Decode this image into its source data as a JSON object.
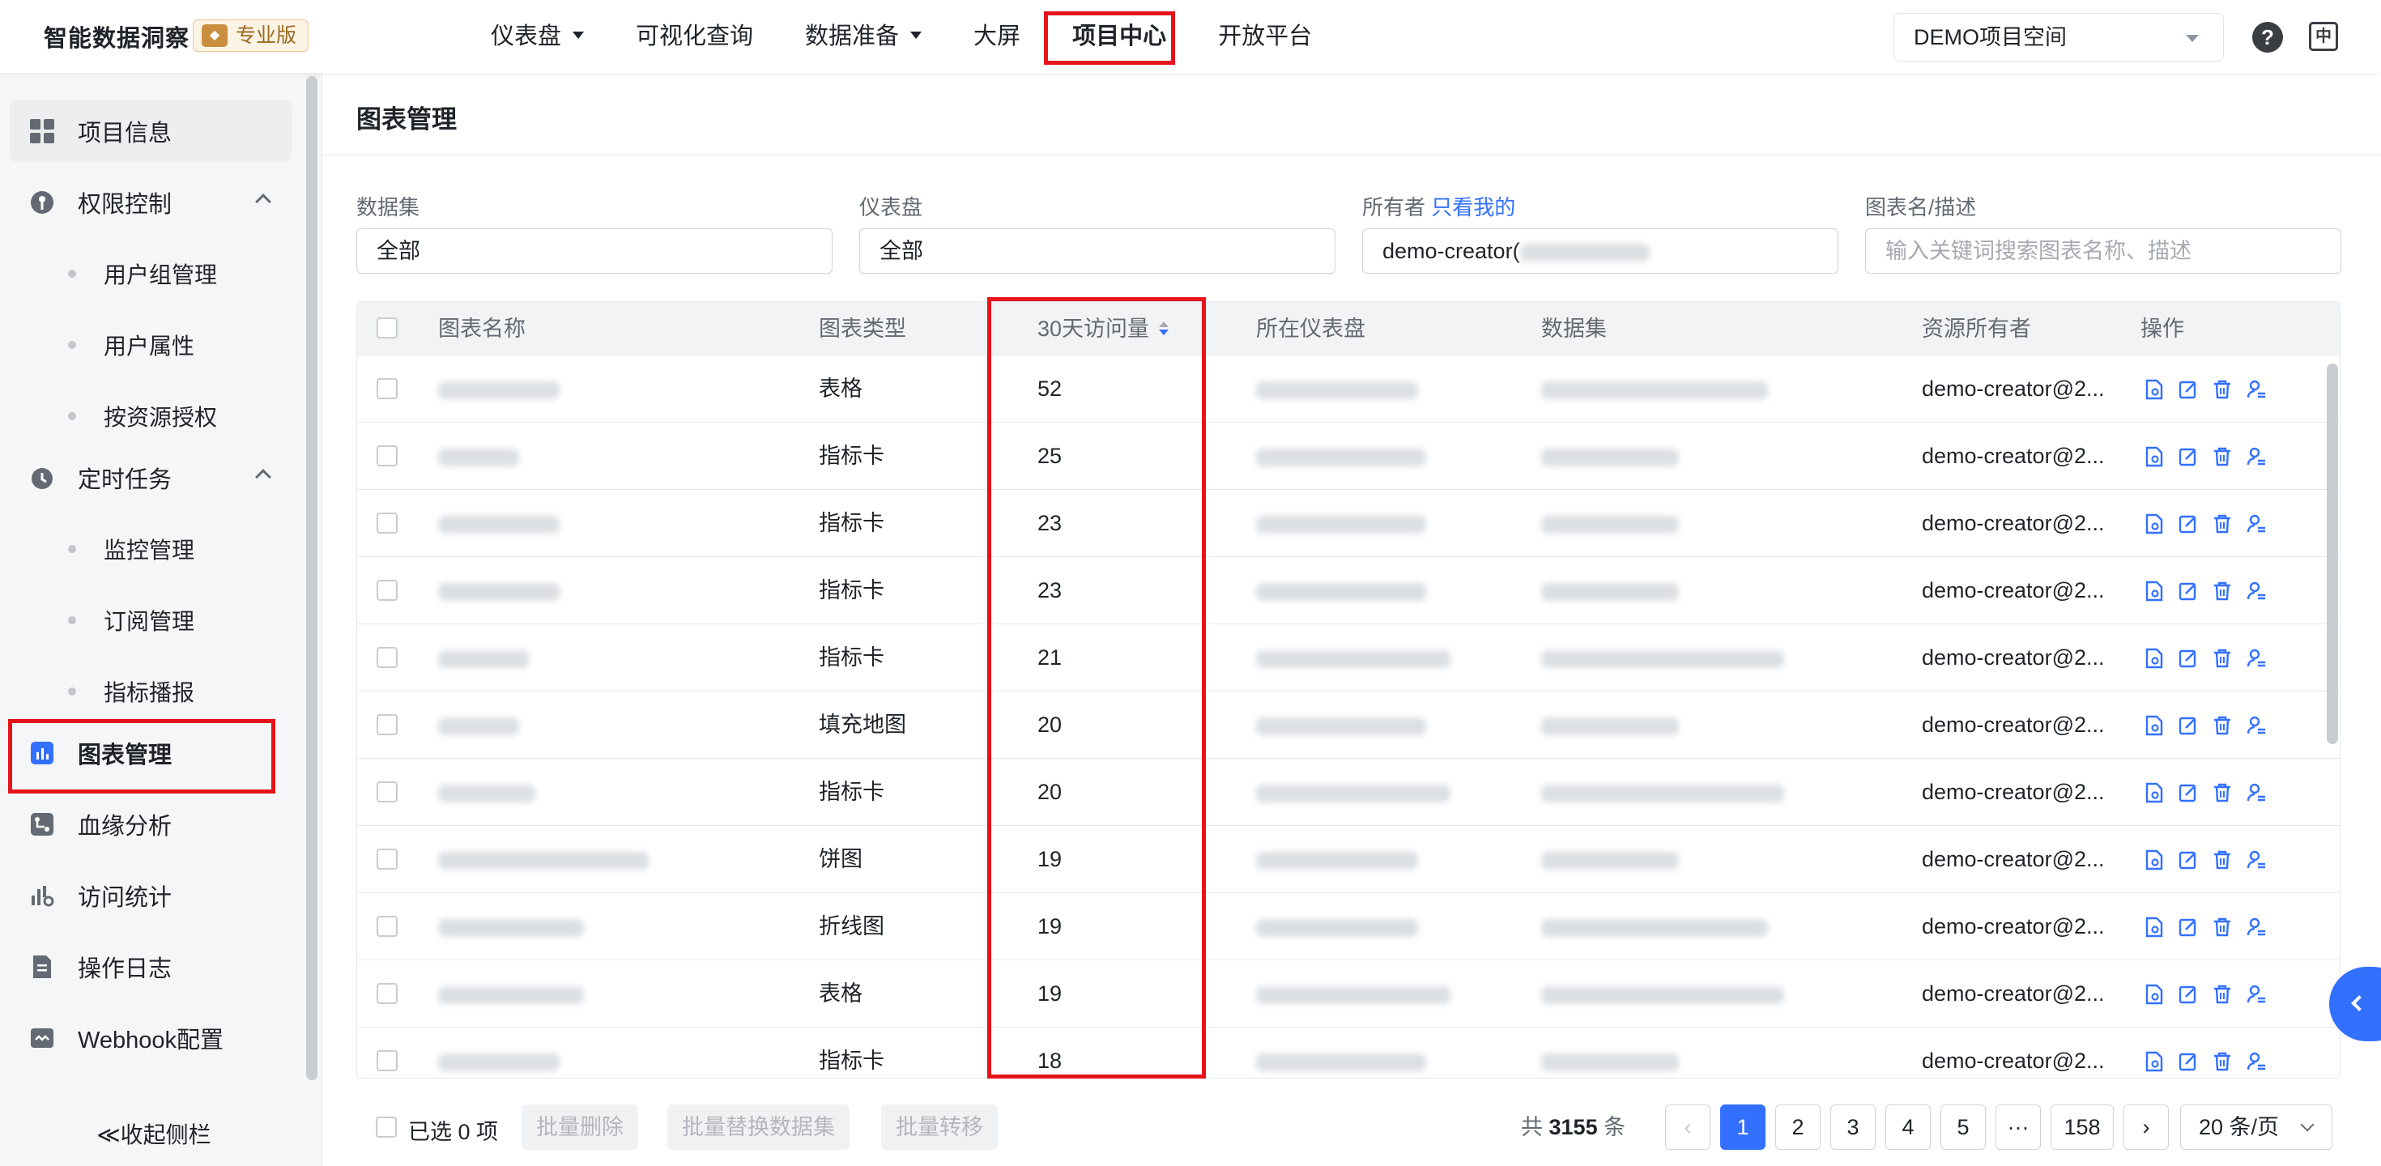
{
  "app": {
    "brand": "智能数据洞察",
    "edition": "专业版"
  },
  "nav": {
    "items": [
      {
        "label": "仪表盘",
        "dropdown": true
      },
      {
        "label": "可视化查询",
        "dropdown": false
      },
      {
        "label": "数据准备",
        "dropdown": true
      },
      {
        "label": "大屏",
        "dropdown": false
      },
      {
        "label": "项目中心",
        "dropdown": false,
        "active": true
      },
      {
        "label": "开放平台",
        "dropdown": false
      }
    ],
    "project_select": "DEMO项目空间",
    "help_icon": "?",
    "lang_icon": "中"
  },
  "sidebar": {
    "items": [
      {
        "label": "项目信息",
        "icon": "grid-icon"
      },
      {
        "label": "权限控制",
        "icon": "key-icon",
        "expanded": true
      },
      {
        "label": "用户组管理"
      },
      {
        "label": "用户属性"
      },
      {
        "label": "按资源授权"
      },
      {
        "label": "定时任务",
        "icon": "clock-icon",
        "expanded": true
      },
      {
        "label": "监控管理"
      },
      {
        "label": "订阅管理"
      },
      {
        "label": "指标播报"
      },
      {
        "label": "图表管理",
        "icon": "bar-chart-icon",
        "selected": true
      },
      {
        "label": "血缘分析",
        "icon": "lineage-icon"
      },
      {
        "label": "访问统计",
        "icon": "stats-icon"
      },
      {
        "label": "操作日志",
        "icon": "log-icon"
      },
      {
        "label": "Webhook配置",
        "icon": "webhook-icon"
      }
    ],
    "collapse_label": "≪收起侧栏"
  },
  "page": {
    "title": "图表管理",
    "filters": {
      "dataset_label": "数据集",
      "dataset_value": "全部",
      "dashboard_label": "仪表盘",
      "dashboard_value": "全部",
      "owner_label": "所有者",
      "owner_link": "只看我的",
      "owner_value": "demo-creator(",
      "search_label": "图表名/描述",
      "search_placeholder": "输入关键词搜索图表名称、描述"
    },
    "table": {
      "columns": [
        "图表名称",
        "图表类型",
        "30天访问量",
        "所在仪表盘",
        "数据集",
        "资源所有者",
        "操作"
      ],
      "rows": [
        {
          "type": "表格",
          "visits": "52",
          "owner": "demo-creator@2..."
        },
        {
          "type": "指标卡",
          "visits": "25",
          "owner": "demo-creator@2..."
        },
        {
          "type": "指标卡",
          "visits": "23",
          "owner": "demo-creator@2..."
        },
        {
          "type": "指标卡",
          "visits": "23",
          "owner": "demo-creator@2..."
        },
        {
          "type": "指标卡",
          "visits": "21",
          "owner": "demo-creator@2..."
        },
        {
          "type": "填充地图",
          "visits": "20",
          "owner": "demo-creator@2..."
        },
        {
          "type": "指标卡",
          "visits": "20",
          "owner": "demo-creator@2..."
        },
        {
          "type": "饼图",
          "visits": "19",
          "owner": "demo-creator@2..."
        },
        {
          "type": "折线图",
          "visits": "19",
          "owner": "demo-creator@2..."
        },
        {
          "type": "表格",
          "visits": "19",
          "owner": "demo-creator@2..."
        },
        {
          "type": "指标卡",
          "visits": "18",
          "owner": "demo-creator@2..."
        }
      ],
      "op_icons": [
        "detail-icon",
        "edit-icon",
        "delete-icon",
        "transfer-icon"
      ]
    },
    "footer": {
      "selected": "已选 0 项",
      "batch_delete": "批量删除",
      "batch_replace": "批量替换数据集",
      "batch_transfer": "批量转移",
      "total_prefix": "共",
      "total": "3155",
      "total_suffix": "条",
      "pages": [
        "1",
        "2",
        "3",
        "4",
        "5",
        "···",
        "158"
      ],
      "current_page": "1",
      "prev": "‹",
      "next": "›",
      "page_size": "20 条/页"
    }
  },
  "colors": {
    "accent": "#3370ff",
    "highlight": "#e5141a"
  }
}
